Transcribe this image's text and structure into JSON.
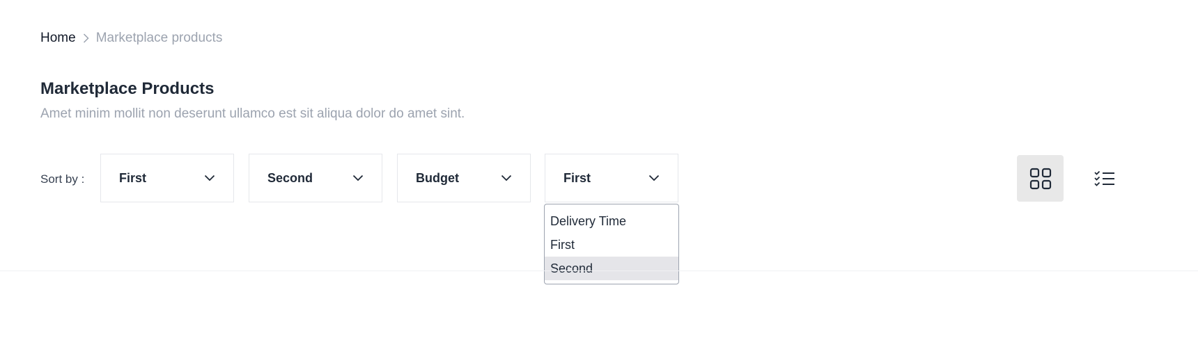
{
  "breadcrumb": {
    "home": "Home",
    "current": "Marketplace products"
  },
  "page": {
    "title": "Marketplace Products",
    "subtitle": "Amet minim mollit non deserunt ullamco est sit aliqua dolor do amet sint."
  },
  "sort": {
    "label": "Sort by :",
    "selects": [
      {
        "value": "First"
      },
      {
        "value": "Second"
      },
      {
        "value": "Budget"
      },
      {
        "value": "First"
      }
    ],
    "dropdown": {
      "options": [
        "Delivery Time",
        "First",
        "Second"
      ],
      "highlighted": "Second"
    }
  },
  "view": {
    "active": "grid",
    "icons": [
      "grid-view-icon",
      "list-view-icon"
    ]
  },
  "colors": {
    "text": "#111827",
    "muted": "#9ca3af",
    "border": "#e5e7eb",
    "active_bg": "#e8e8e8",
    "highlight_bg": "#e5e5e9"
  }
}
